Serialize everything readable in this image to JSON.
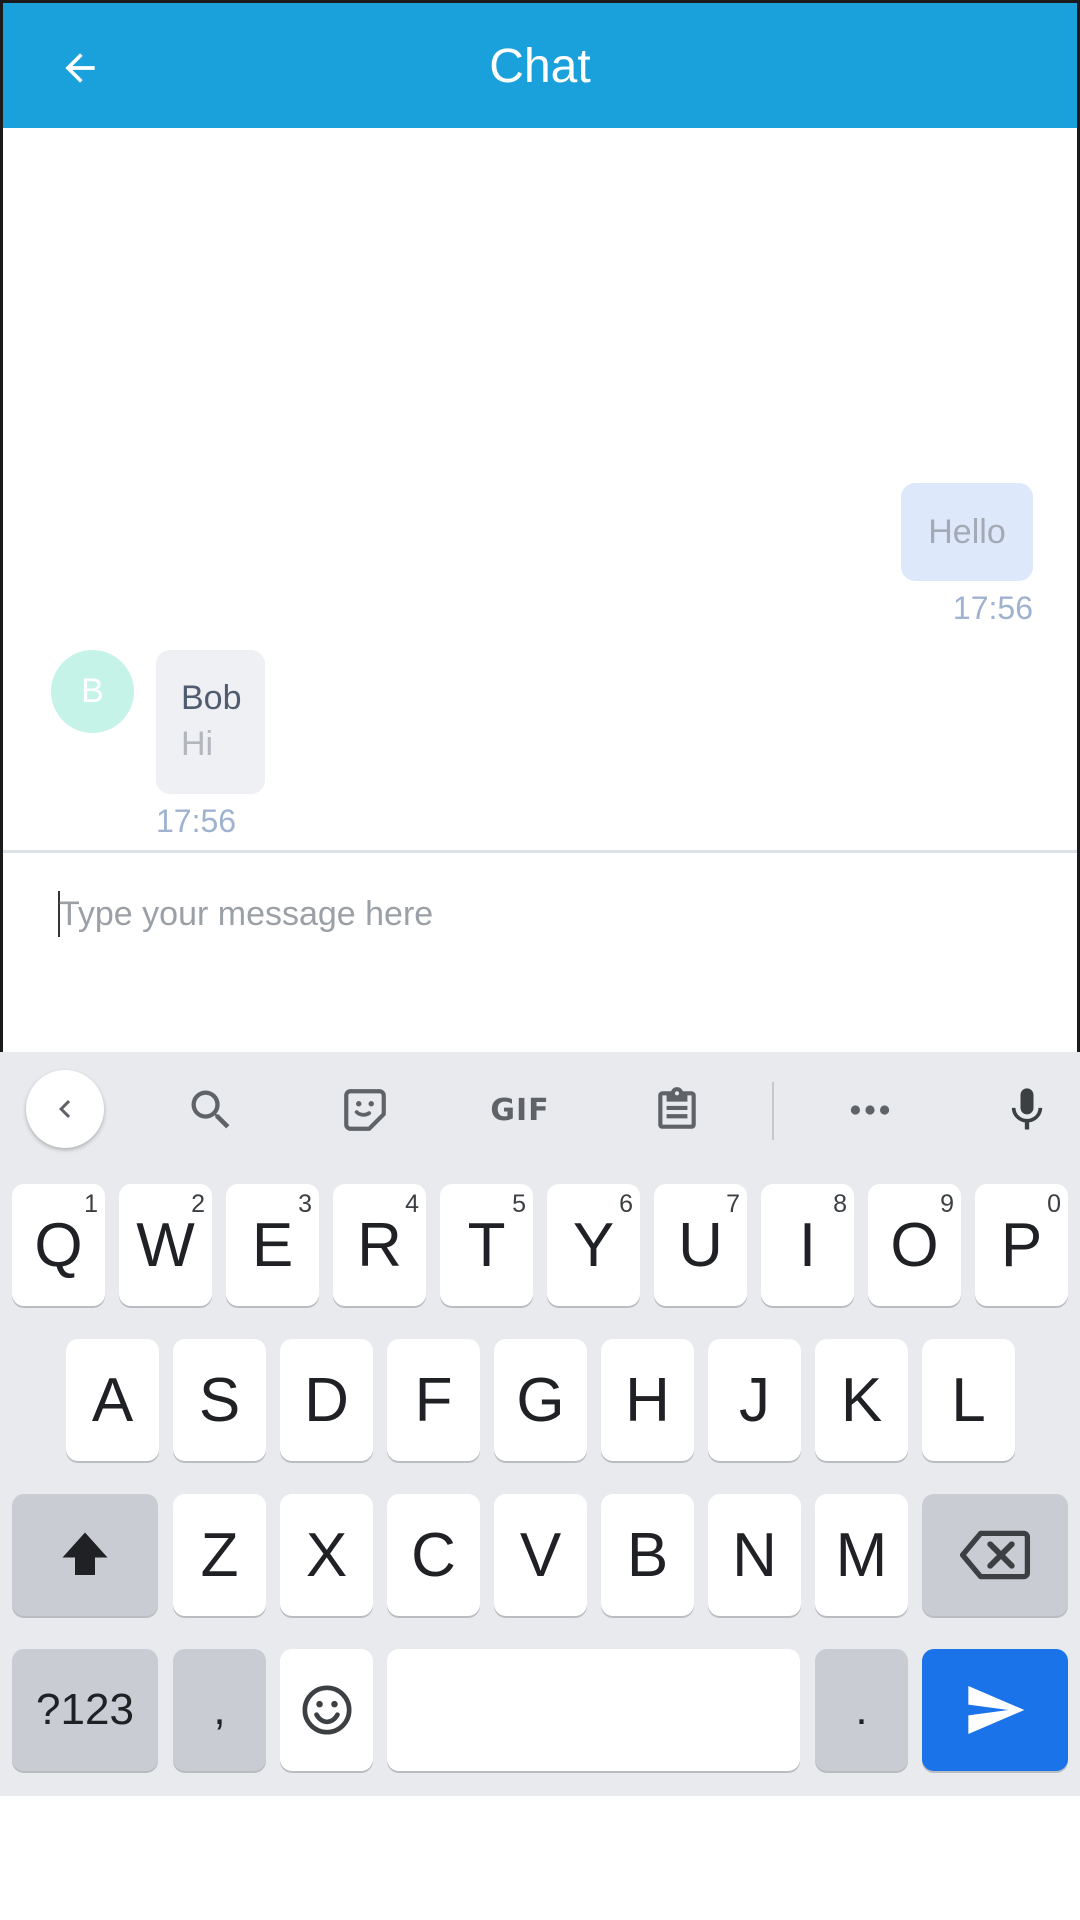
{
  "header": {
    "title": "Chat",
    "back_icon": "arrow-left-icon",
    "background": "#1aa1dc"
  },
  "messages": {
    "outgoing": {
      "text": "Hello",
      "time": "17:56"
    },
    "incoming": {
      "avatar_letter": "B",
      "sender": "Bob",
      "text": "Hi",
      "time": "17:56"
    }
  },
  "composer": {
    "placeholder": "Type your message here",
    "value": ""
  },
  "keyboard": {
    "toolbar": {
      "icons": [
        "chevron-left-icon",
        "search-icon",
        "sticker-icon",
        "gif-icon",
        "clipboard-icon",
        "more-icon",
        "microphone-icon"
      ],
      "gif_label": "GIF"
    },
    "row1": {
      "letters": [
        "Q",
        "W",
        "E",
        "R",
        "T",
        "Y",
        "U",
        "I",
        "O",
        "P"
      ],
      "hints": [
        "1",
        "2",
        "3",
        "4",
        "5",
        "6",
        "7",
        "8",
        "9",
        "0"
      ]
    },
    "row2": {
      "letters": [
        "A",
        "S",
        "D",
        "F",
        "G",
        "H",
        "J",
        "K",
        "L"
      ]
    },
    "row3": {
      "letters": [
        "Z",
        "X",
        "C",
        "V",
        "B",
        "N",
        "M"
      ]
    },
    "row4": {
      "symbols_label": "?123",
      "comma": ",",
      "period": "."
    },
    "accent_color": "#1a73e8"
  }
}
